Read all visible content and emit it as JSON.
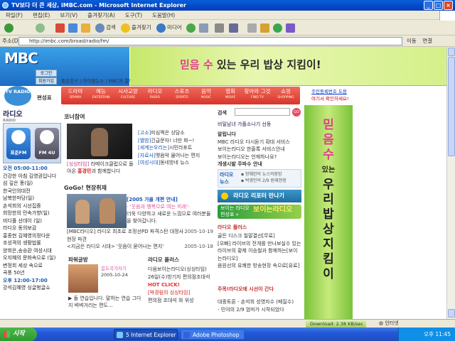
{
  "window": {
    "title": "TV보다 더 큰 세상, iMBC.com - Microsoft Internet Explorer",
    "minimize": "_",
    "maximize": "□",
    "close": "×"
  },
  "menu": [
    "파일(F)",
    "편집(E)",
    "보기(V)",
    "즐겨찾기(A)",
    "도구(T)",
    "도움말(H)"
  ],
  "toolbar": {
    "back": "",
    "search": "검색",
    "favorites": "즐겨찾기",
    "media": "미디어"
  },
  "address": {
    "label": "주소(D)",
    "url": "http://imbc.com/broad/radio/fm/",
    "go": "이동",
    "links": "연결"
  },
  "header": {
    "logo": "MBC",
    "onair": "on air",
    "login": "로그인",
    "join": "회원가입",
    "links": "좋은친구 | 아이엠뉴스 | MBC와 함께",
    "banner_a": "믿음 수",
    "banner_b": " 있는 우리 밥상 지킴이!"
  },
  "left": {
    "tvradio": "TV RADIO",
    "fav": "편성표"
  },
  "nav": [
    {
      "label": "드라마",
      "en": "DRAMA"
    },
    {
      "label": "예능",
      "en": "ENTERTAIN"
    },
    {
      "label": "시사교양",
      "en": "CULTURE"
    },
    {
      "label": "라디오",
      "en": "RADIO"
    },
    {
      "label": "스포츠",
      "en": "SPORTS"
    },
    {
      "label": "음악",
      "en": "MUSIC"
    },
    {
      "label": "영화",
      "en": "MOVIE"
    },
    {
      "label": "찾아라 그것",
      "en": "FIND TV"
    },
    {
      "label": "쇼핑",
      "en": "SHOPPING"
    }
  ],
  "promo": {
    "l1": "주민등록번호 도용",
    "l2": "여기서 확인하세요!"
  },
  "sidebar": {
    "title": "라디오",
    "subtitle": "RADIO",
    "btn1": "표준FM",
    "btn2": "FM 4U",
    "morning": "오전 05:00-11:00",
    "items": [
      "건강한 아침 김영권입니다",
      "섬 깊은 풍(일)",
      "한국인의대전",
      "남북한마당(일)",
      "손석희의 시선집중",
      "희망한의 민속가향(일)",
      "비디폴 선데이 (일)",
      "라디오 동의보감",
      "홍종현 김혜영의정다운",
      "조성격의 생활법률",
      "양희은,송승환 여성시대",
      "오지혜의 문화속으로 (일)",
      "변정희 세상 속으로",
      "곡풍 50년"
    ],
    "afternoon": "오후 12:00-17:00",
    "items2": [
      "강석김혜영 싱글벙글쇼"
    ]
  },
  "corner": {
    "title": "코너참여",
    "cap_a": "[싱싱타임] ",
    "cap_b": "라메이크클럽으로 돌아온 ",
    "cap_c": "홍경민",
    "cap_d": "과 함께합니다",
    "list": [
      {
        "tag": "[고소]",
        "text": "미심쩍은 상담소"
      },
      {
        "tag": "[별밤]",
        "text": "긴급문자! 너만 봐~!"
      },
      {
        "tag": "[세계는우리는]",
        "text": "시민라포트"
      },
      {
        "tag": "[자료사]",
        "text": "옛음악 물어나는 편지"
      },
      {
        "tag": "[여성시대]",
        "text": "동네방네 뉴스"
      }
    ]
  },
  "gogo": {
    "title": "GoGo! 현장취재",
    "feat_tag": "[2005 가을 개편 안내]",
    "feat_sub": "- '웃음과 행복으로 여는 미래'-",
    "feat_body": "더욱 다양하고 새로운 느낌으로 여러분들을 찾아갑니다.",
    "news": [
      {
        "text": "[MBC라디오] 라디오 최초로 조정선PD 파격스탄 대정사 현장 파견",
        "date": "2005-10-19"
      },
      {
        "text": "<지금은 라디오 시대> '웃음이 묻어나는 편지'",
        "date": "2005-10-18"
      }
    ]
  },
  "power": {
    "title": "파워글방",
    "date": "2005-10-24",
    "tag": "음도곡가자기",
    "text": "▶ 돌 연습입니다. 말하는 연습 그다지 벼벼거리는 편도..."
  },
  "rplus": {
    "title": "라디오 플러스",
    "l1": "다음보이는라디오(싱싱타임)",
    "l2": "26일(수)방기자 편의점조대석",
    "l3": "HOT",
    "l4": "CLICK!",
    "l5": "[박경림의 싱싱타임]",
    "l6": "편의점 조대석 와 위성"
  },
  "right": {
    "search_label": "검색",
    "search_go": "GO",
    "links": "비밀남녀 가플소나기 선동",
    "notice_h": "알립니다",
    "notices": [
      "MBC 라디오 다시듣기 확대 서비스",
      "보이는라디오 한줄록 서비스안내",
      "보이는라디오는 언제하나요?",
      "개생시발 주파수 안내"
    ],
    "rn_label": "라디오 뉴스",
    "rn_items": [
      "▪ 항혜한의 뉴스의장망",
      "▪ 박영민의 2/9 원재현정"
    ],
    "reporter": "라디오 리포터 만나기",
    "card_a": "보이는 라디오",
    "card_b": "편성표 »",
    "card_big": "보이는라디오",
    "plus": "라디오 플러스",
    "plus_items": [
      "골든 디스크 칠말결선[무료]",
      "[오빠] 라이브의 전개를 만나보실수 있는 라이브의 황제 이승철과 함께하는[보이는라디오]",
      "음원선의 유쾌한 방송현장 속으로[유료]"
    ],
    "ex": "주목!라디오에 시선이 간다",
    "ex_items": [
      "대중토론 - 손석희 성영자수 (배질수)",
      "- 민야의 2/9 엄마가 시작되었다"
    ]
  },
  "vbanner": [
    "믿",
    "음",
    "수",
    "있는",
    "우",
    "리",
    "밥",
    "상",
    "지",
    "킴",
    "이"
  ],
  "status": {
    "text": "",
    "download": "Download: 2.38 KB/sec",
    "zone": "인터넷"
  },
  "taskbar": {
    "start": "시작",
    "t1": "5 Internet Explorer",
    "t2": "Adobe Photoshop",
    "clock": "오후 11:45"
  }
}
